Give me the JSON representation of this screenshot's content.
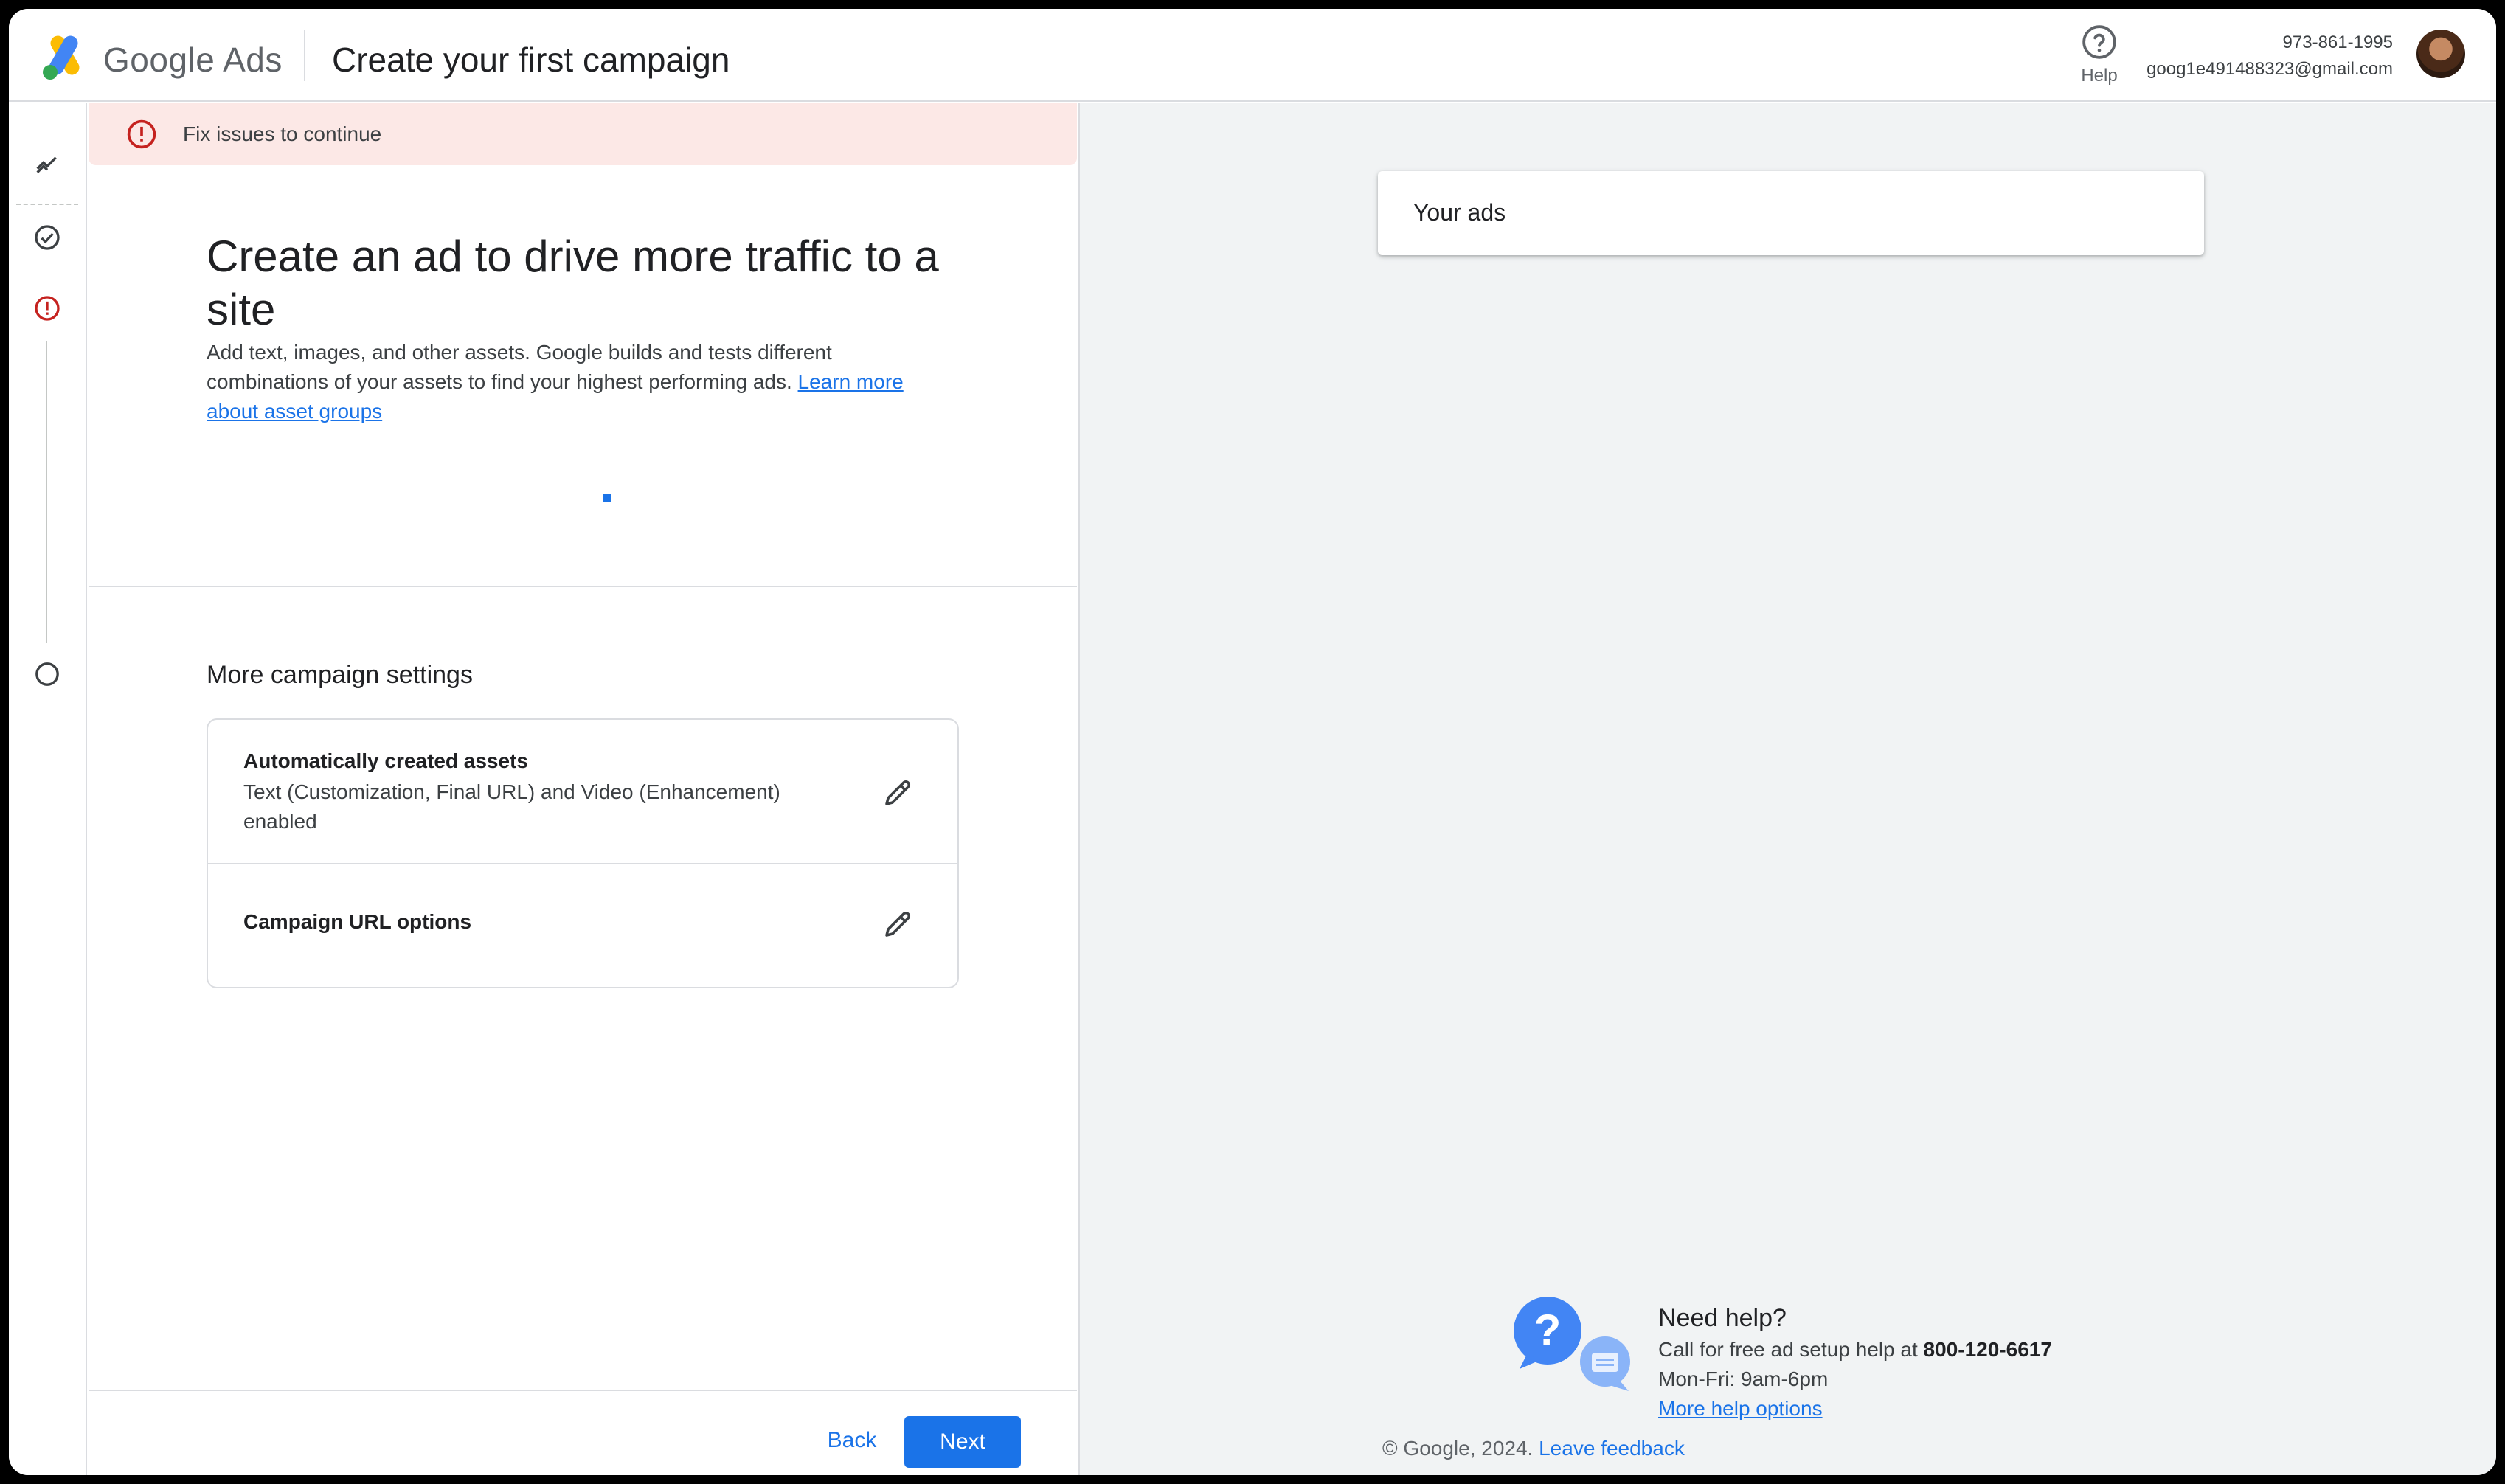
{
  "header": {
    "brand": "Google Ads",
    "title": "Create your first campaign",
    "help_label": "Help",
    "account_phone": "973-861-1995",
    "account_email": "goog1e491488323@gmail.com"
  },
  "rail": {
    "icons": [
      "trend-icon",
      "check-circle-icon",
      "error-icon",
      "empty-circle-icon"
    ]
  },
  "form": {
    "error_banner": "Fix issues to continue",
    "section_title": "Create an ad to drive more traffic to a site",
    "section_desc": "Add text, images, and other assets. Google builds and tests different combinations of your assets to find your highest performing ads.",
    "learn_more_link": "Learn more about asset groups",
    "more_settings_title": "More campaign settings",
    "settings": [
      {
        "name": "Automatically created assets",
        "detail": "Text (Customization, Final URL) and Video (Enhancement) enabled"
      },
      {
        "name": "Campaign URL options",
        "detail": ""
      }
    ],
    "back_label": "Back",
    "next_label": "Next"
  },
  "preview": {
    "your_ads_label": "Your ads",
    "need_help_title": "Need help?",
    "call_text": "Call for free ad setup help at",
    "phone": "800-120-6617",
    "hours": "Mon-Fri: 9am-6pm",
    "more_help_link": "More help options",
    "copyright": "© Google, 2024.",
    "feedback_link": "Leave feedback"
  },
  "colors": {
    "accent": "#1a73e8",
    "error": "#c5221f",
    "error_bg": "#fce8e6",
    "panel_bg": "#f1f3f4"
  }
}
